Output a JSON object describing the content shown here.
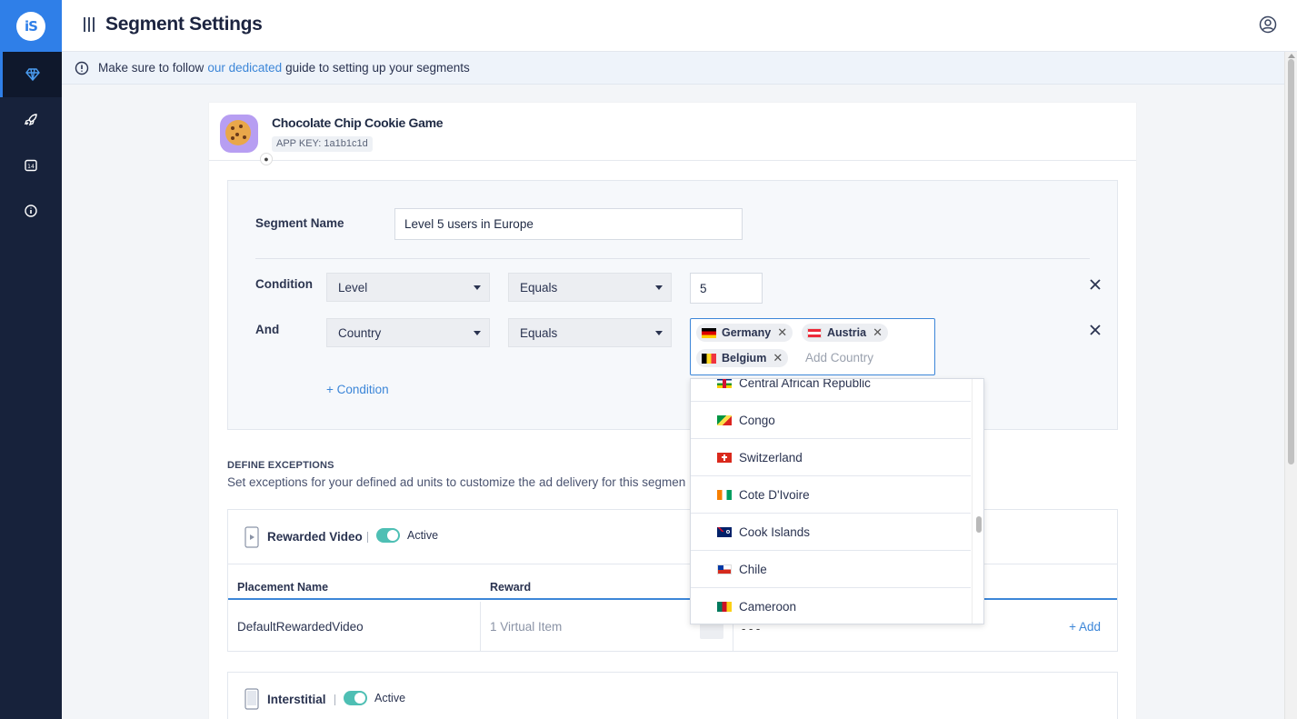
{
  "app": {
    "logo_text": "iS",
    "page_title": "Segment Settings"
  },
  "sidebar": {
    "items": [
      {
        "icon": "diamond-icon",
        "active": true
      },
      {
        "icon": "rocket-icon",
        "active": false
      },
      {
        "icon": "calendar-icon",
        "label": "14",
        "active": false
      },
      {
        "icon": "info-icon",
        "active": false
      }
    ]
  },
  "info_bar": {
    "text_before": "Make sure to follow",
    "link_text": "our dedicated",
    "text_after": "guide to setting up your segments"
  },
  "app_card": {
    "name": "Chocolate Chip Cookie Game",
    "app_key": "APP KEY: 1a1b1c1d",
    "platform_icon": "apple-icon"
  },
  "segment": {
    "name_label": "Segment Name",
    "name_value": "Level 5 users in Europe",
    "conditions": [
      {
        "label": "Condition",
        "field": "Level",
        "operator": "Equals",
        "value": "5"
      },
      {
        "label": "And",
        "field": "Country",
        "operator": "Equals"
      }
    ],
    "countries_selected": [
      "Germany",
      "Austria",
      "Belgium"
    ],
    "country_placeholder": "Add Country",
    "add_condition": "+ Condition"
  },
  "country_dropdown": {
    "items": [
      "Central African Republic",
      "Congo",
      "Switzerland",
      "Cote D'Ivoire",
      "Cook Islands",
      "Chile",
      "Cameroon"
    ]
  },
  "exceptions": {
    "title": "DEFINE EXCEPTIONS",
    "description": "Set exceptions for your defined ad units to customize the ad delivery for this segmen",
    "rewarded": {
      "name": "Rewarded Video",
      "status": "Active",
      "columns": [
        "Placement Name",
        "Reward"
      ],
      "row": {
        "placement": "DefaultRewardedVideo",
        "reward": "1 Virtual Item",
        "dashes": "- - -",
        "add": "+ Add"
      }
    },
    "interstitial": {
      "name": "Interstitial",
      "status": "Active"
    }
  },
  "colors": {
    "sidebar_bg": "#17223b",
    "brand_blue": "#2f7fe8",
    "link_blue": "#3c86d8",
    "toggle_teal": "#4ebfb4"
  }
}
